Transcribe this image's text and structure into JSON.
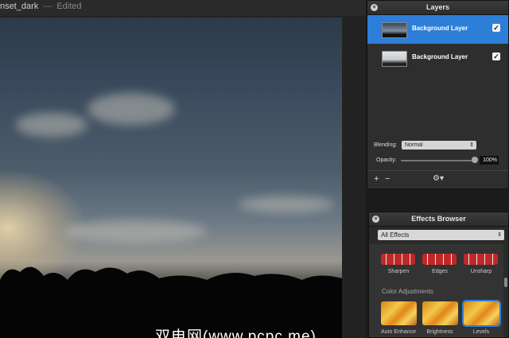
{
  "window": {
    "doc_name": "nset_dark",
    "separator": "—",
    "status": "Edited"
  },
  "watermark": "双电网(www.pcpc.me)",
  "layers_panel": {
    "title": "Layers",
    "close": "×",
    "layers": [
      {
        "name": "Background Layer",
        "visible": "✓",
        "selected": true
      },
      {
        "name": "Background Layer",
        "visible": "✓",
        "selected": false
      }
    ],
    "blending_label": "Blending:",
    "blending_value": "Normal",
    "opacity_label": "Opacity:",
    "opacity_value": "100%",
    "add": "+",
    "remove": "−",
    "gear": "⚙▾"
  },
  "effects_panel": {
    "title": "Effects Browser",
    "close": "×",
    "category": "All Effects",
    "row1": [
      "Sharpen",
      "Edges",
      "Unsharp"
    ],
    "section": "Color Adjustments",
    "row2": [
      "Auto Enhance",
      "Brightness",
      "Levels"
    ]
  },
  "colors": {
    "accent": "#2d7ed8",
    "panel": "#2e2e2e"
  }
}
